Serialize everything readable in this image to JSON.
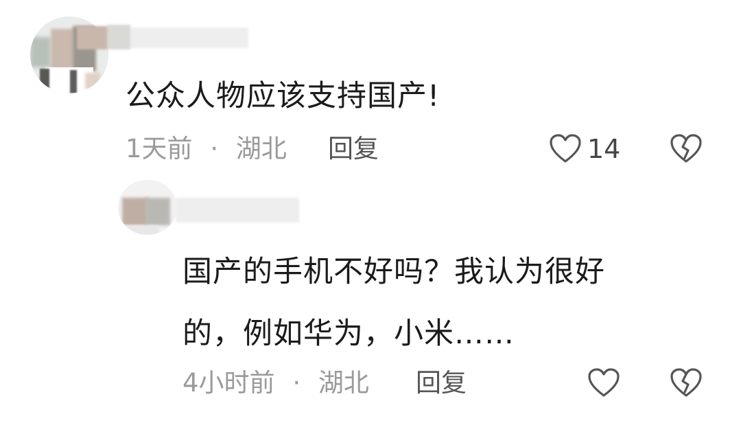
{
  "comments": [
    {
      "text": "公众人物应该支持国产!",
      "time": "1天前",
      "separator": "·",
      "location": "湖北",
      "reply_label": "回复",
      "like_count": "14",
      "like_icon": "heart-outline-icon",
      "dislike_icon": "broken-heart-icon",
      "reply": {
        "text_line1": "国产的手机不好吗？我认为很好",
        "text_line2": "的，例如华为，小米……",
        "time": "4小时前",
        "separator": "·",
        "location": "湖北",
        "reply_label": "回复",
        "like_count": "",
        "like_icon": "heart-outline-icon",
        "dislike_icon": "broken-heart-icon"
      }
    }
  ],
  "colors": {
    "text": "#1b1b1b",
    "meta": "#9a9a9a",
    "reply": "#555555",
    "icon": "#555555"
  }
}
